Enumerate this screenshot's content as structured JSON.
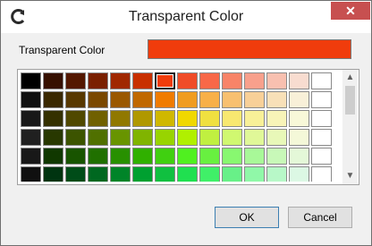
{
  "window": {
    "title": "Transparent Color",
    "close_glyph": "✕"
  },
  "field": {
    "label": "Transparent Color",
    "value_color": "#f03c0c"
  },
  "palette": {
    "selected": [
      5,
      0
    ],
    "rows": [
      [
        "#000000",
        "#361000",
        "#541800",
        "#7a2000",
        "#a02800",
        "#c83000",
        "#f03c0c",
        "#f04c28",
        "#f86848",
        "#f88468",
        "#f8a08c",
        "#f8c0b0",
        "#f8dcd0",
        "#ffffff"
      ],
      [
        "#101010",
        "#3a2800",
        "#583800",
        "#7a4800",
        "#9a5800",
        "#c06800",
        "#f07c00",
        "#f09c20",
        "#f8b048",
        "#f8c070",
        "#f8d098",
        "#f8e0b8",
        "#f8f0d8",
        "#ffffff"
      ],
      [
        "#181818",
        "#343000",
        "#504800",
        "#706000",
        "#907800",
        "#b09800",
        "#d0b800",
        "#f0d800",
        "#f0e040",
        "#f8e870",
        "#f8f098",
        "#f8f4b8",
        "#f8f8d8",
        "#ffffff"
      ],
      [
        "#202020",
        "#283800",
        "#3c5400",
        "#507000",
        "#689400",
        "#80b400",
        "#98d400",
        "#b0f000",
        "#c0f040",
        "#d0f870",
        "#e0f898",
        "#e8f8b8",
        "#f4f8d8",
        "#ffffff"
      ],
      [
        "#181818",
        "#103800",
        "#185400",
        "#207000",
        "#289000",
        "#30b000",
        "#40d010",
        "#50f020",
        "#68f040",
        "#88f870",
        "#a8f898",
        "#c8f8b8",
        "#e4f8d8",
        "#ffffff"
      ],
      [
        "#101010",
        "#003410",
        "#004c18",
        "#006820",
        "#008428",
        "#00a030",
        "#10c040",
        "#20e050",
        "#40f068",
        "#68f088",
        "#90f8a8",
        "#b8f8c8",
        "#dcf8e4",
        "#ffffff"
      ]
    ]
  },
  "scrollbar": {
    "up_glyph": "▲",
    "down_glyph": "▼"
  },
  "buttons": {
    "ok": "OK",
    "cancel": "Cancel"
  }
}
